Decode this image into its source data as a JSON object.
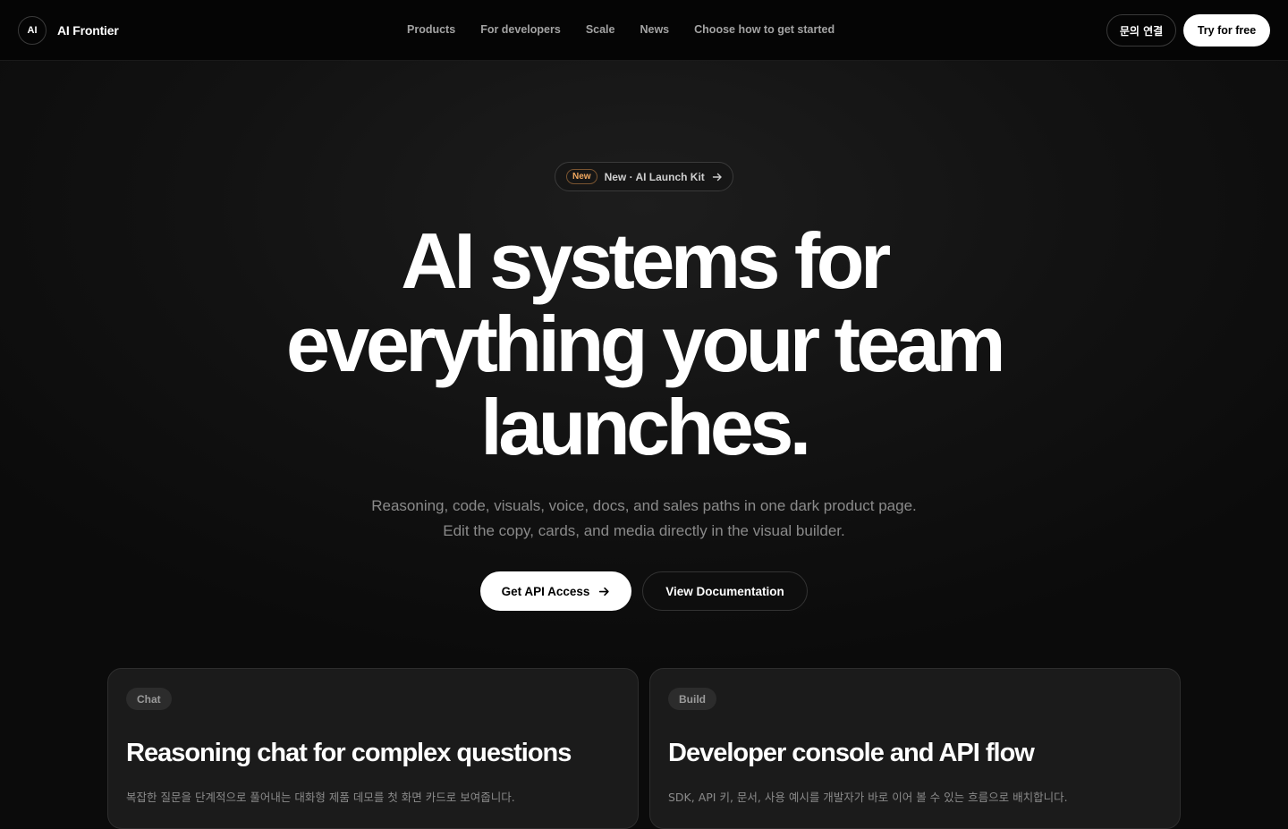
{
  "brand": {
    "mark": "AI",
    "name": "AI Frontier"
  },
  "nav": [
    "Products",
    "For developers",
    "Scale",
    "News",
    "Choose how to get started"
  ],
  "header": {
    "contact_label": "문의 연결",
    "try_label": "Try for free"
  },
  "announcement": {
    "badge": "New",
    "text": "New · AI Launch Kit",
    "icon": "arrow-right-icon"
  },
  "hero": {
    "headline_lines": [
      "AI systems for",
      "everything your team",
      "launches."
    ],
    "subcopy_lines": [
      "Reasoning, code, visuals, voice, docs, and sales paths in one dark product page.",
      "Edit the copy, cards, and media directly in the visual builder."
    ],
    "primary_cta": "Get API Access",
    "secondary_cta": "View Documentation"
  },
  "cards": [
    {
      "tag": "Chat",
      "title": "Reasoning chat for complex questions",
      "desc": "복잡한 질문을 단계적으로 풀어내는 대화형 제품 데모를 첫 화면 카드로 보여줍니다."
    },
    {
      "tag": "Build",
      "title": "Developer console and API flow",
      "desc": "SDK, API 키, 문서, 사용 예시를 개발자가 바로 이어 볼 수 있는 흐름으로 배치합니다."
    }
  ],
  "colors": {
    "background": "#0b0b0b",
    "accent_badge": "#f0a860",
    "primary_button": "#ffffff"
  }
}
